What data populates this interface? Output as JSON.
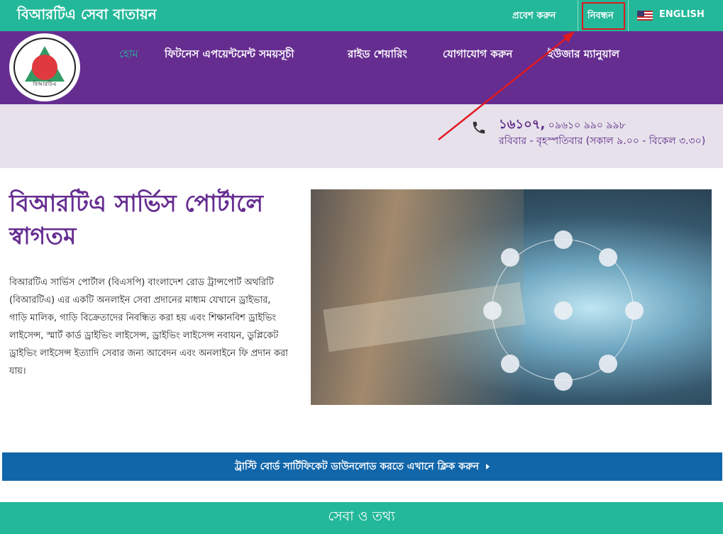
{
  "topbar": {
    "site_title": "বিআরটিএ সেবা বাতায়ন",
    "login_label": "প্রবেশ করুন",
    "register_label": "নিবন্ধন",
    "language_label": "ENGLISH"
  },
  "nav": {
    "logo_text": "বিআরটিএ",
    "items": [
      {
        "label": "হোম"
      },
      {
        "label": "ফিটনেস এপয়েন্টমেন্ট সময়সূচী"
      },
      {
        "label": "রাইড শেয়ারিং"
      },
      {
        "label": "যোগাযোগ করুন"
      },
      {
        "label": "ইউজার ম্যানুয়াল"
      }
    ]
  },
  "contact": {
    "hotline": "১৬১০৭,",
    "alt_phone": " ০৯৬১০ ৯৯০ ৯৯৮",
    "hours": "রবিবার - বৃহস্পতিবার (সকাল ৯.০০ - বিকেল ৩.৩০)"
  },
  "main": {
    "welcome_title": "বিআরটিএ সার্ভিস পোর্টালে স্বাগতম",
    "intro_text": "বিআরটিএ সার্ভিস পোর্টাল (বিএসপি) বাংলাদেশ রোড ট্রান্সপোর্ট অথরিটি (বিআরটিএ) এর একটি অনলাইন সেবা প্রদানের মাধ্যম যেখানে ড্রাইভার, গাড়ি মালিক, গাড়ি বিক্রেতাদের নিবন্ধিত করা হয় এবং শিক্ষানবিশ ড্রাইভিং লাইসেন্স, স্মার্ট কার্ড ড্রাইভিং লাইসেন্স, ড্রাইভিং লাইসেন্স নবায়ন, ডুপ্লিকেট ড্রাইভিং লাইসেন্স ইত্যাদি সেবার জন্য আবেদন এবং অনলাইনে ফি প্রদান করা যায়।"
  },
  "banner": {
    "label": "ট্রাস্টি বোর্ড সার্টিফিকেট ডাউনলোড করতে এখানে ক্লিক করুন"
  },
  "section": {
    "title": "সেবা ও তথ্য"
  },
  "colors": {
    "teal": "#23b899",
    "purple": "#662d91",
    "band": "#e7e1ec",
    "banner_blue": "#1166aa",
    "annotation_red": "#e0191f"
  }
}
